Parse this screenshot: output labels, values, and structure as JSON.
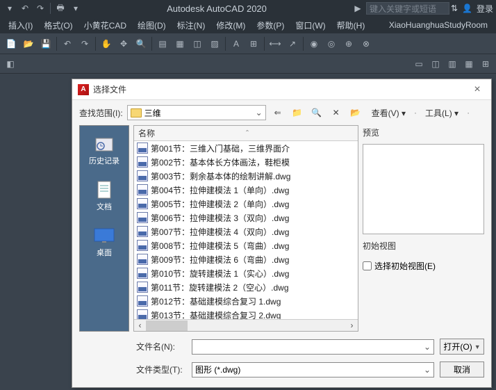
{
  "app": {
    "title": "Autodesk AutoCAD 2020",
    "search_placeholder": "键入关键字或短语",
    "login_label": "登录",
    "doc_tab": "XiaoHuanghuaStudyRoom"
  },
  "menu": {
    "items": [
      "插入(I)",
      "格式(O)",
      "小黄花CAD",
      "绘图(D)",
      "标注(N)",
      "修改(M)",
      "参数(P)",
      "窗口(W)",
      "帮助(H)"
    ]
  },
  "dialog": {
    "title": "选择文件",
    "lookin_label": "查找范围(I):",
    "folder": "三维",
    "view_label": "查看(V)",
    "tools_label": "工具(L)",
    "places": [
      {
        "id": "history",
        "label": "历史记录"
      },
      {
        "id": "documents",
        "label": "文档"
      },
      {
        "id": "desktop",
        "label": "桌面"
      }
    ],
    "column_header": "名称",
    "files": [
      "第001节：三维入门基础，三维界面介",
      "第002节：基本体长方体画法，鞋柜模",
      "第003节：剩余基本体的绘制讲解.dwg",
      "第004节：拉伸建模法 1（单向）.dwg",
      "第005节：拉伸建模法 2（单向）.dwg",
      "第006节：拉伸建模法 3（双向）.dwg",
      "第007节：拉伸建模法 4（双向）.dwg",
      "第008节：拉伸建模法 5（弯曲）.dwg",
      "第009节：拉伸建模法 6（弯曲）.dwg",
      "第010节：旋转建模法 1（实心）.dwg",
      "第011节：旋转建模法 2（空心）.dwg",
      "第012节：基础建模综合复习 1.dwg",
      "第013节：基础建模综合复习 2.dwg"
    ],
    "preview_label": "预览",
    "initview_label": "初始视图",
    "initview_checkbox": "选择初始视图(E)",
    "filename_label": "文件名(N):",
    "filename_value": "",
    "filetype_label": "文件类型(T):",
    "filetype_value": "图形 (*.dwg)",
    "open_btn": "打开(O)",
    "cancel_btn": "取消"
  }
}
